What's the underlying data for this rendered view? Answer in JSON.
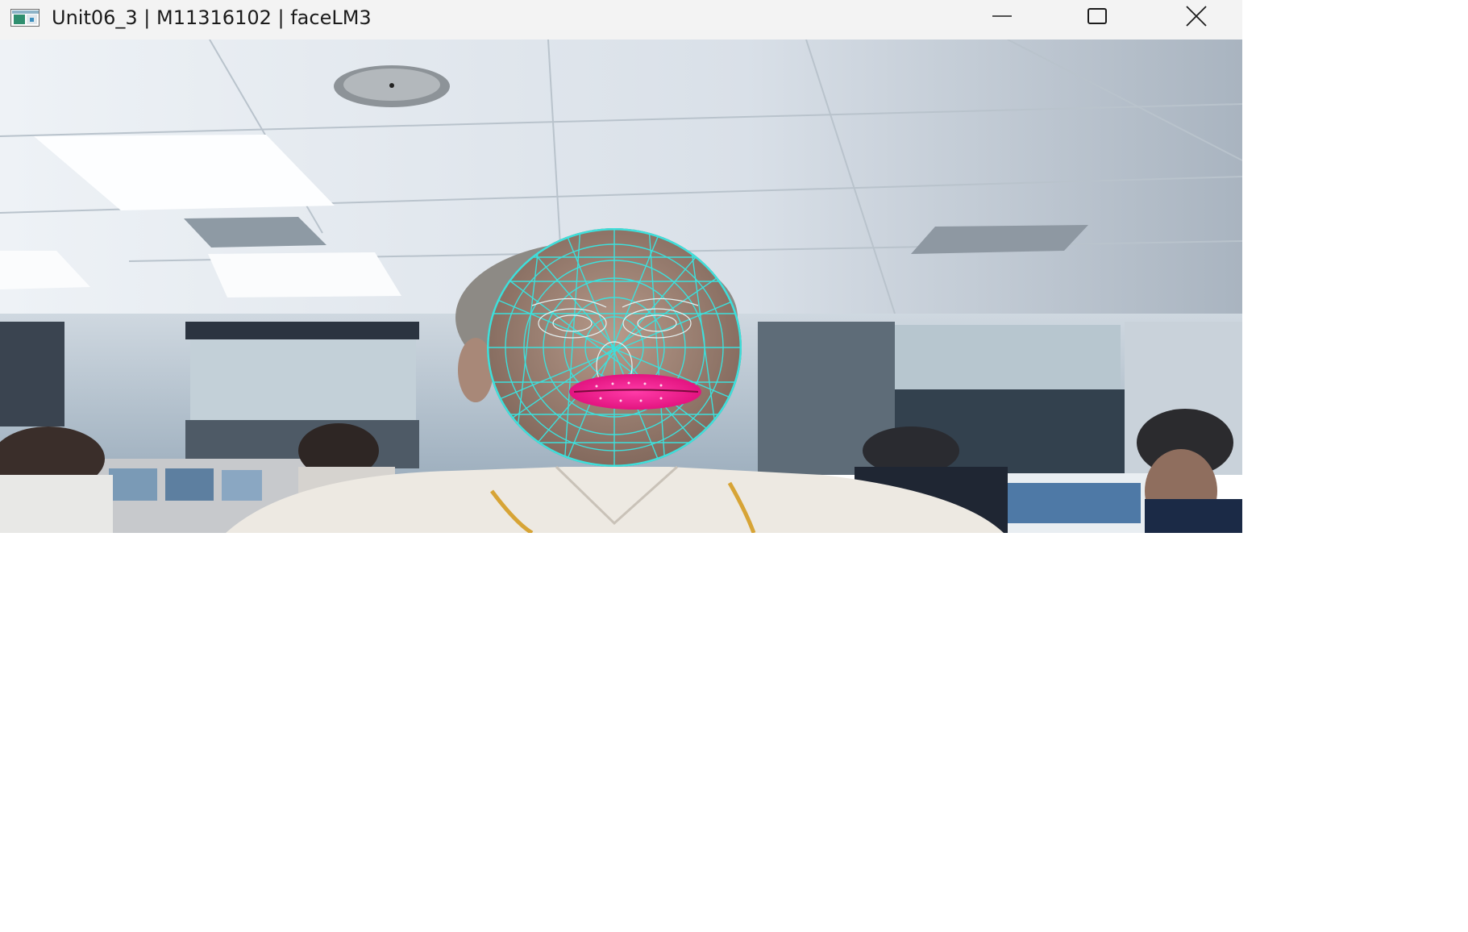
{
  "window": {
    "title": "Unit06_3 | M11316102 | faceLM3",
    "icon": "app-window-icon",
    "controls": {
      "minimize": "minimize-icon",
      "maximize": "maximize-icon",
      "close": "close-icon"
    }
  },
  "video": {
    "content": "webcam-frame",
    "overlay": {
      "mesh_color": "#3de0dc",
      "lips_color": "#ff1493"
    }
  },
  "colors": {
    "titlebar": "#f3f3f3",
    "title_text": "#1b1b1b"
  }
}
